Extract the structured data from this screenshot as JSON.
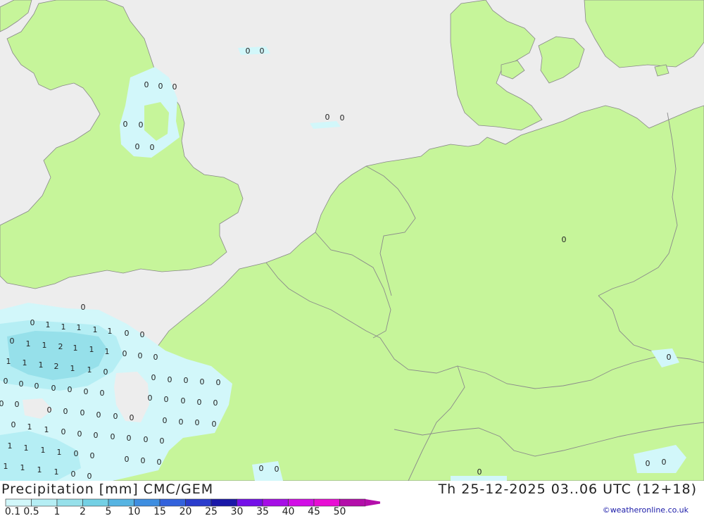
{
  "map": {
    "colors": {
      "sea": "#ededed",
      "land": "#c6f59a",
      "border": "#888888",
      "precip_0_1": "#d2f7fa",
      "precip_0_5": "#b5eef4",
      "precip_1": "#96e0ea"
    },
    "labels": [
      {
        "id": "n1",
        "text": "0"
      },
      {
        "id": "n2",
        "text": "0"
      },
      {
        "id": "n3",
        "text": "0"
      },
      {
        "id": "n4",
        "text": "0"
      },
      {
        "id": "n5",
        "text": "0"
      },
      {
        "id": "n6",
        "text": "0"
      },
      {
        "id": "n7",
        "text": "0"
      },
      {
        "id": "n8",
        "text": "0"
      },
      {
        "id": "n9",
        "text": "0"
      },
      {
        "id": "n10",
        "text": "0"
      },
      {
        "id": "n11",
        "text": "0"
      },
      {
        "id": "n12",
        "text": "0"
      },
      {
        "id": "n13",
        "text": "0"
      },
      {
        "id": "n14",
        "text": "0"
      },
      {
        "id": "n15",
        "text": "0"
      },
      {
        "id": "n16",
        "text": "0"
      },
      {
        "id": "n17",
        "text": "0"
      },
      {
        "id": "n18",
        "text": "0"
      },
      {
        "id": "n19",
        "text": "1"
      },
      {
        "id": "n20",
        "text": "1"
      },
      {
        "id": "n21",
        "text": "1"
      },
      {
        "id": "n22",
        "text": "1"
      },
      {
        "id": "n23",
        "text": "1"
      },
      {
        "id": "n24",
        "text": "0"
      },
      {
        "id": "n25",
        "text": "0"
      },
      {
        "id": "n26",
        "text": "0"
      },
      {
        "id": "n27",
        "text": "1"
      },
      {
        "id": "n28",
        "text": "1"
      },
      {
        "id": "n29",
        "text": "2"
      },
      {
        "id": "n30",
        "text": "1"
      },
      {
        "id": "n31",
        "text": "1"
      },
      {
        "id": "n32",
        "text": "1"
      },
      {
        "id": "n33",
        "text": "0"
      },
      {
        "id": "n34",
        "text": "0"
      },
      {
        "id": "n35",
        "text": "0"
      },
      {
        "id": "n36",
        "text": "1"
      },
      {
        "id": "n37",
        "text": "1"
      },
      {
        "id": "n38",
        "text": "1"
      },
      {
        "id": "n39",
        "text": "2"
      },
      {
        "id": "n40",
        "text": "1"
      },
      {
        "id": "n41",
        "text": "1"
      },
      {
        "id": "n42",
        "text": "0"
      },
      {
        "id": "n43",
        "text": "0"
      },
      {
        "id": "n44",
        "text": "0"
      },
      {
        "id": "n45",
        "text": "0"
      },
      {
        "id": "n46",
        "text": "0"
      },
      {
        "id": "n47",
        "text": "0"
      },
      {
        "id": "n48",
        "text": "0"
      },
      {
        "id": "n49",
        "text": "0"
      },
      {
        "id": "n50",
        "text": "0"
      },
      {
        "id": "n51",
        "text": "0"
      },
      {
        "id": "n52",
        "text": "0"
      },
      {
        "id": "n53",
        "text": "0"
      },
      {
        "id": "n54",
        "text": "0"
      },
      {
        "id": "n55",
        "text": "0"
      },
      {
        "id": "n56",
        "text": "0"
      },
      {
        "id": "n57",
        "text": "0"
      },
      {
        "id": "n58",
        "text": "0"
      },
      {
        "id": "n59",
        "text": "0"
      },
      {
        "id": "n60",
        "text": "0"
      },
      {
        "id": "n61",
        "text": "0"
      },
      {
        "id": "n62",
        "text": "0"
      },
      {
        "id": "n63",
        "text": "0"
      },
      {
        "id": "n64",
        "text": "0"
      },
      {
        "id": "n65",
        "text": "0"
      },
      {
        "id": "n66",
        "text": "0"
      },
      {
        "id": "n67",
        "text": "0"
      },
      {
        "id": "n68",
        "text": "0"
      },
      {
        "id": "n69",
        "text": "0"
      },
      {
        "id": "n70",
        "text": "0"
      },
      {
        "id": "n71",
        "text": "0"
      },
      {
        "id": "n72",
        "text": "0"
      },
      {
        "id": "n73",
        "text": "0"
      },
      {
        "id": "n74",
        "text": "1"
      },
      {
        "id": "n75",
        "text": "1"
      },
      {
        "id": "n76",
        "text": "0"
      },
      {
        "id": "n77",
        "text": "0"
      },
      {
        "id": "n78",
        "text": "0"
      },
      {
        "id": "n79",
        "text": "0"
      },
      {
        "id": "n80",
        "text": "0"
      },
      {
        "id": "n81",
        "text": "0"
      },
      {
        "id": "n82",
        "text": "0"
      },
      {
        "id": "n83",
        "text": "0"
      },
      {
        "id": "n84",
        "text": "0"
      },
      {
        "id": "n85",
        "text": "0"
      },
      {
        "id": "n86",
        "text": "0"
      },
      {
        "id": "n87",
        "text": "1"
      },
      {
        "id": "n88",
        "text": "1"
      },
      {
        "id": "n89",
        "text": "1"
      },
      {
        "id": "n90",
        "text": "1"
      },
      {
        "id": "n91",
        "text": "0"
      },
      {
        "id": "n92",
        "text": "0"
      },
      {
        "id": "n93",
        "text": "0"
      },
      {
        "id": "n94",
        "text": "0"
      },
      {
        "id": "n95",
        "text": "0"
      },
      {
        "id": "n96",
        "text": "0"
      },
      {
        "id": "n97",
        "text": "1"
      },
      {
        "id": "n98",
        "text": "1"
      },
      {
        "id": "n99",
        "text": "1"
      },
      {
        "id": "n100",
        "text": "1"
      },
      {
        "id": "n101",
        "text": "0"
      },
      {
        "id": "n102",
        "text": "0"
      },
      {
        "id": "n103",
        "text": "0"
      },
      {
        "id": "n104",
        "text": "0"
      },
      {
        "id": "n105",
        "text": "1"
      },
      {
        "id": "n106",
        "text": "1"
      },
      {
        "id": "n107",
        "text": "1"
      },
      {
        "id": "n108",
        "text": "1"
      },
      {
        "id": "n109",
        "text": "1"
      },
      {
        "id": "n110",
        "text": "0"
      },
      {
        "id": "n111",
        "text": "0"
      },
      {
        "id": "n112",
        "text": "0"
      },
      {
        "id": "n113",
        "text": "0"
      },
      {
        "id": "n114",
        "text": "0"
      },
      {
        "id": "n115",
        "text": "0"
      },
      {
        "id": "n116",
        "text": "0"
      },
      {
        "id": "n117",
        "text": "0"
      },
      {
        "id": "n118",
        "text": "0"
      },
      {
        "id": "n119",
        "text": "0"
      },
      {
        "id": "n120",
        "text": "0"
      },
      {
        "id": "n121",
        "text": "0"
      },
      {
        "id": "n122",
        "text": "0"
      },
      {
        "id": "n123",
        "text": "0"
      },
      {
        "id": "n124",
        "text": "0"
      },
      {
        "id": "n125",
        "text": "0"
      }
    ]
  },
  "footer": {
    "title": "Precipitation [mm] CMC/GEM",
    "datetime": "Th 25-12-2025 03..06 UTC (12+18)",
    "credit": "©weatheronline.co.uk",
    "legend": [
      {
        "label": "0.1",
        "color": "#d2f7fa"
      },
      {
        "label": "0.5",
        "color": "#b5eef4"
      },
      {
        "label": "1",
        "color": "#96e0ea"
      },
      {
        "label": "2",
        "color": "#73d0e4"
      },
      {
        "label": "5",
        "color": "#56b4e2"
      },
      {
        "label": "10",
        "color": "#3f8ee0"
      },
      {
        "label": "15",
        "color": "#3362dc"
      },
      {
        "label": "20",
        "color": "#2a3ccc"
      },
      {
        "label": "25",
        "color": "#1a18a8"
      },
      {
        "label": "30",
        "color": "#7410e8"
      },
      {
        "label": "35",
        "color": "#a60ee6"
      },
      {
        "label": "40",
        "color": "#d20ee6"
      },
      {
        "label": "45",
        "color": "#e80ed4"
      },
      {
        "label": "50",
        "color": "#b40eaa"
      }
    ]
  }
}
